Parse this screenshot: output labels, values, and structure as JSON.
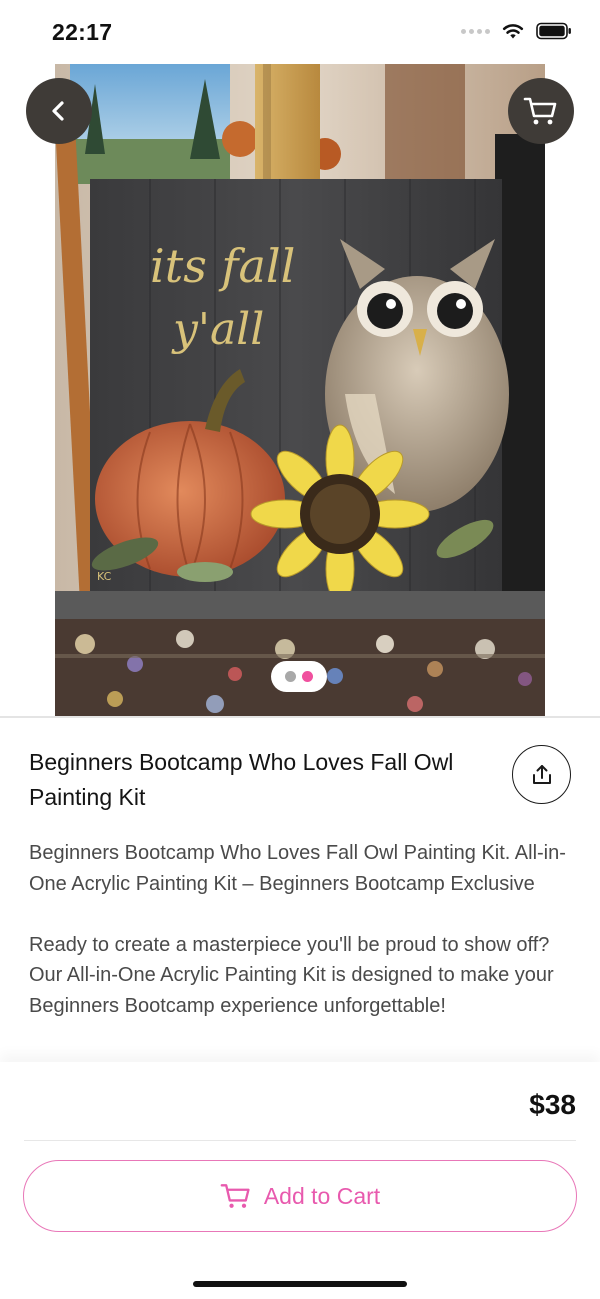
{
  "status_bar": {
    "time": "22:17",
    "icons": [
      "signal-dots-icon",
      "wifi-icon",
      "battery-icon"
    ]
  },
  "header": {
    "back_icon": "chevron-left-icon",
    "cart_icon": "cart-icon"
  },
  "carousel": {
    "page_count": 2,
    "active_index": 1,
    "colors": {
      "active": "#f0509e",
      "inactive": "#a8a8a8"
    },
    "artwork_text": [
      "its fall",
      "y'all",
      "KC"
    ]
  },
  "product": {
    "title": "Beginners Bootcamp Who Loves Fall Owl Painting Kit",
    "share_icon": "share-icon",
    "description": [
      "Beginners Bootcamp Who Loves Fall Owl Painting Kit. All-in-One Acrylic Painting Kit – Beginners Bootcamp Exclusive",
      "Ready to create a masterpiece you'll be proud to show off? Our All-in-One Acrylic Painting Kit is designed to make your Beginners Bootcamp experience unforgettable!"
    ]
  },
  "purchase": {
    "price": "$38",
    "add_to_cart_label": "Add to Cart",
    "accent_color": "#e85aae"
  }
}
